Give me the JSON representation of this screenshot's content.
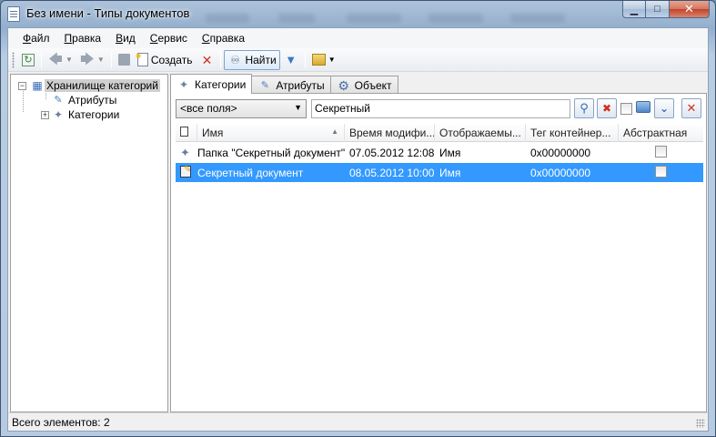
{
  "window": {
    "title": "Без имени - Типы документов"
  },
  "menu": [
    {
      "u": "Ф",
      "rest": "айл"
    },
    {
      "u": "П",
      "rest": "равка"
    },
    {
      "u": "В",
      "rest": "ид"
    },
    {
      "u": "С",
      "rest": "ервис"
    },
    {
      "u": "С",
      "rest": "правка"
    }
  ],
  "toolbar": {
    "create_label": "Создать",
    "find_label": "Найти"
  },
  "tree": {
    "root": "Хранилище категорий",
    "children": [
      "Атрибуты",
      "Категории"
    ]
  },
  "tabs": [
    "Категории",
    "Атрибуты",
    "Объект"
  ],
  "filter": {
    "field_select": "<все поля>",
    "search_value": "Секретный"
  },
  "grid": {
    "columns": [
      "Имя",
      "Время модифи...",
      "Отображаемы...",
      "Тег контейнер...",
      "Абстрактная"
    ],
    "rows": [
      {
        "name": "Папка \"Секретный документ\"",
        "modified": "07.05.2012 12:08...",
        "display": "Имя",
        "tag": "0x00000000"
      },
      {
        "name": "Секретный документ",
        "modified": "08.05.2012 10:00...",
        "display": "Имя",
        "tag": "0x00000000"
      }
    ]
  },
  "status": {
    "text": "Всего элементов: 2"
  },
  "colors": {
    "selection": "#3399ff",
    "frame": "#93afcd"
  }
}
